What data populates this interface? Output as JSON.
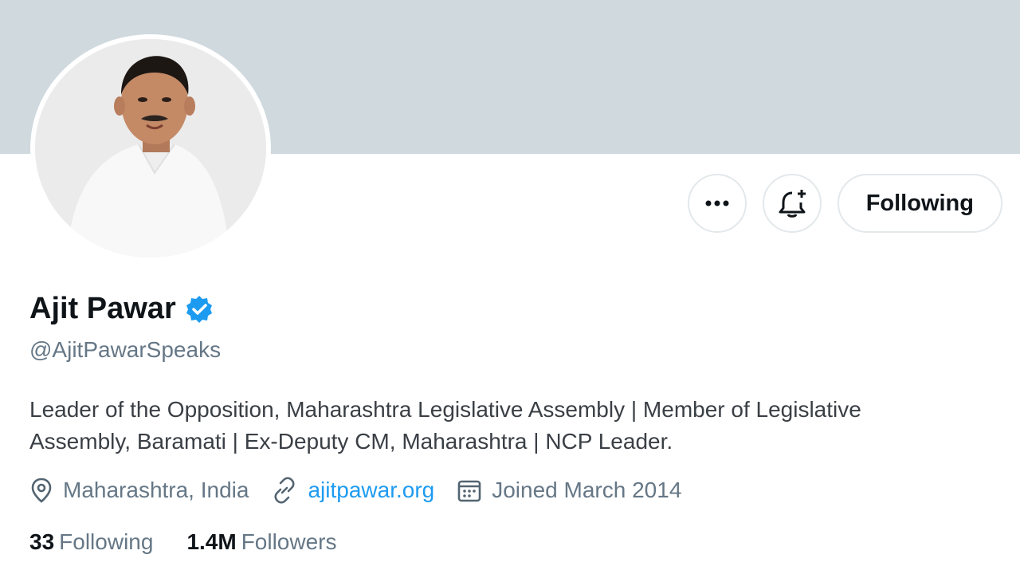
{
  "profile": {
    "name": "Ajit Pawar",
    "verified": true,
    "handle": "@AjitPawarSpeaks",
    "bio": "Leader of the Opposition, Maharashtra Legislative Assembly | Member of Legislative Assembly, Baramati | Ex-Deputy CM, Maharashtra | NCP Leader.",
    "location": "Maharashtra, India",
    "website": "ajitpawar.org",
    "joined": "Joined March 2014"
  },
  "stats": {
    "following_count": "33",
    "following_label": "Following",
    "followers_count": "1.4M",
    "followers_label": "Followers"
  },
  "actions": {
    "follow_label": "Following",
    "more_icon": "more-icon",
    "notify_icon": "bell-plus-icon"
  },
  "icons": {
    "verified": "verified-badge-icon",
    "location": "location-pin-icon",
    "link": "link-icon",
    "calendar": "calendar-icon"
  },
  "colors": {
    "banner": "#cfd9de",
    "verified": "#1d9bf0",
    "link": "#1d9bf0",
    "secondary_text": "#657786"
  }
}
